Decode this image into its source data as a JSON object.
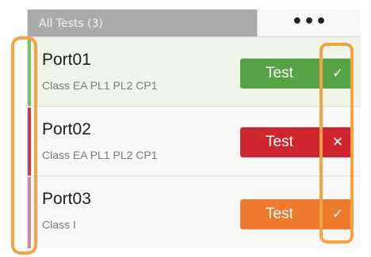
{
  "header": {
    "title": "All Tests (3)",
    "more_label": "•••"
  },
  "rows": [
    {
      "port": "Port01",
      "class": "Class EA PL1 PL2 CP1",
      "button_label": "Test",
      "status": "pass",
      "status_symbol": "✓",
      "button_color": "#57a447",
      "accent_color": "#7dbb6b"
    },
    {
      "port": "Port02",
      "class": "Class EA PL1 PL2 CP1",
      "button_label": "Test",
      "status": "fail",
      "status_symbol": "✕",
      "button_color": "#d0252e",
      "accent_color": "#c53a4c"
    },
    {
      "port": "Port03",
      "class": "Class I",
      "button_label": "Test",
      "status": "pass",
      "status_symbol": "✓",
      "button_color": "#ee7a2e",
      "accent_color": "#c08aa0"
    }
  ],
  "colors": {
    "highlight": "#f2a444",
    "header_bg": "#aaaaab"
  }
}
